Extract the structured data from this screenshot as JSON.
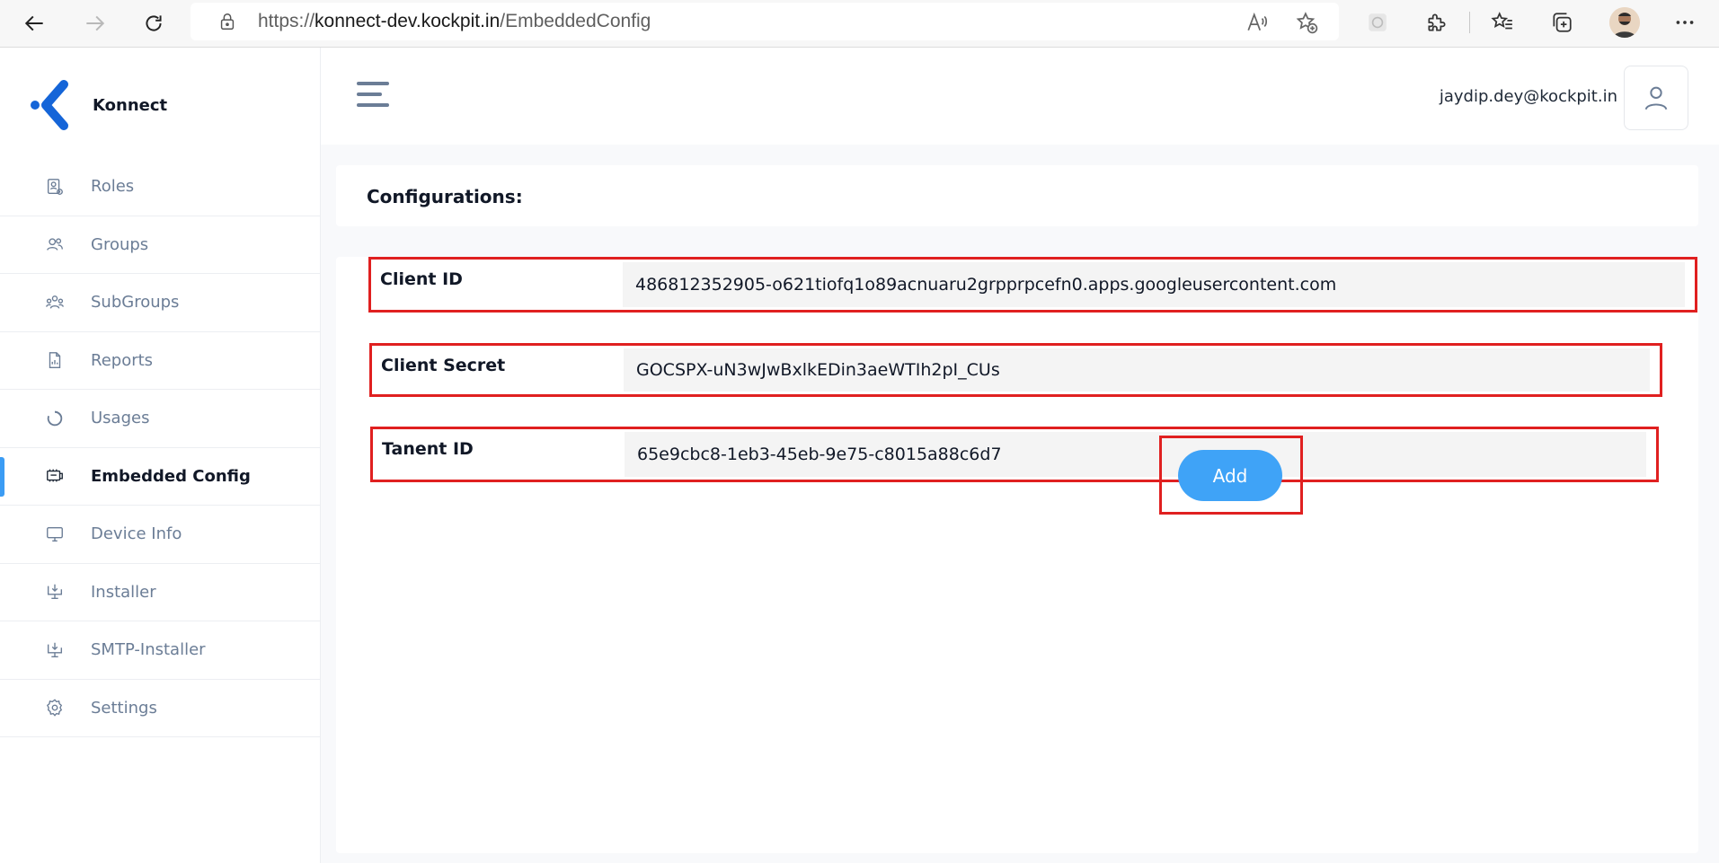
{
  "browser": {
    "url_scheme_host_prefix": "https://",
    "url_host": "konnect-dev.kockpit.in",
    "url_path": "/EmbeddedConfig",
    "icons": [
      "back-icon",
      "forward-icon",
      "refresh-icon",
      "lock-icon",
      "read-aloud-icon",
      "add-favorite-icon",
      "extension-icon",
      "puzzle-icon",
      "favorites-icon",
      "collections-icon",
      "profile-avatar",
      "more-icon"
    ]
  },
  "brand": {
    "name": "Konnect",
    "accent_color": "#1565d8",
    "dot_color": "#1565d8"
  },
  "sidebar": {
    "items": [
      {
        "label": "Roles",
        "icon": "roles-icon",
        "active": false
      },
      {
        "label": "Groups",
        "icon": "groups-icon",
        "active": false
      },
      {
        "label": "SubGroups",
        "icon": "subgroups-icon",
        "active": false
      },
      {
        "label": "Reports",
        "icon": "reports-icon",
        "active": false
      },
      {
        "label": "Usages",
        "icon": "usages-icon",
        "active": false
      },
      {
        "label": "Embedded Config",
        "icon": "embedded-config-icon",
        "active": true
      },
      {
        "label": "Device Info",
        "icon": "device-info-icon",
        "active": false
      },
      {
        "label": "Installer",
        "icon": "installer-icon",
        "active": false
      },
      {
        "label": "SMTP-Installer",
        "icon": "smtp-installer-icon",
        "active": false
      },
      {
        "label": "Settings",
        "icon": "settings-icon",
        "active": false
      }
    ]
  },
  "header": {
    "user_email": "jaydip.dey@kockpit.in"
  },
  "page": {
    "title": "Configurations:",
    "fields": [
      {
        "label": "Client ID",
        "value": "486812352905-o621tiofq1o89acnuaru2grpprpcefn0.apps.googleusercontent.com"
      },
      {
        "label": "Client Secret",
        "value": "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"
      },
      {
        "label": "Tanent ID",
        "value": "65e9cbc8-1eb3-45eb-9e75-c8015a88c6d7"
      }
    ],
    "add_label": "Add"
  },
  "colors": {
    "highlight_border": "#e02020",
    "primary_button": "#3fa3f7",
    "active_indicator": "#3b9cf4",
    "sidebar_text": "#6b7d96"
  }
}
